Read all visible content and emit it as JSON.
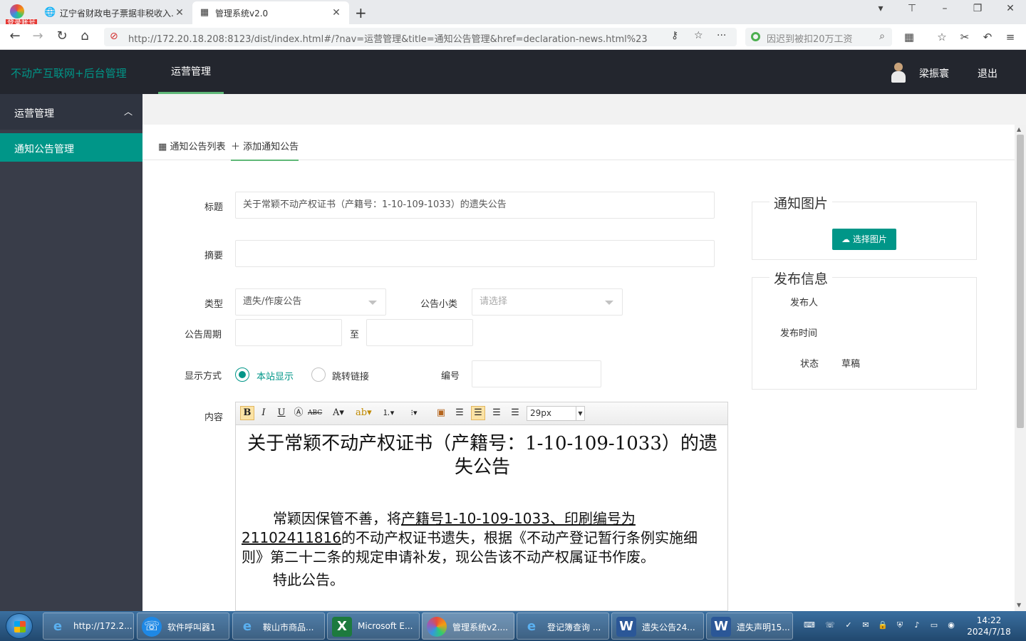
{
  "browser": {
    "login_badge": "登录账号",
    "tabs": [
      {
        "title": "辽宁省财政电子票据非税收入..."
      },
      {
        "title": "管理系统v2.0"
      }
    ],
    "url": "http://172.20.18.208:8123/dist/index.html#/?nav=运营管理&title=通知公告管理&href=declaration-news.html%23",
    "search_text": "因迟到被扣20万工资"
  },
  "app": {
    "brand": "不动产互联网+后台管理",
    "nav_item": "运营管理",
    "user_name": "梁振寰",
    "logout": "退出"
  },
  "sidebar": {
    "group": "运营管理",
    "item": "通知公告管理"
  },
  "page_tabs": {
    "list": "通知公告列表",
    "add": "添加通知公告"
  },
  "form": {
    "title_label": "标题",
    "title_value": "关于常颖不动产权证书（产籍号：1-10-109-1033）的遗失公告",
    "summary_label": "摘要",
    "summary_value": "",
    "type_label": "类型",
    "type_value": "遗失/作废公告",
    "subtype_label": "公告小类",
    "subtype_placeholder": "请选择",
    "period_label": "公告周期",
    "period_to": "至",
    "display_label": "显示方式",
    "display_options": [
      "本站显示",
      "跳转链接"
    ],
    "display_selected": "本站显示",
    "number_label": "编号",
    "content_label": "内容"
  },
  "editor": {
    "font_size": "29px",
    "heading": "关于常颖不动产权证书（产籍号：1-10-109-1033）的遗失公告",
    "body_pre": "常颖因保管不善，将",
    "body_underlined": "产籍号1-10-109-1033、印刷编号为21102411816",
    "body_post": "的不动产权证书遗失，根据《不动产登记暂行条例实施细则》第二十二条的规定申请补发，现公告该不动产权属证书作废。",
    "closing": "特此公告。"
  },
  "right_panel": {
    "image_legend": "通知图片",
    "pick_button": "选择图片",
    "publish_legend": "发布信息",
    "publisher_label": "发布人",
    "publish_time_label": "发布时间",
    "status_label": "状态",
    "status_value": "草稿"
  },
  "taskbar": {
    "tasks": [
      "http://172.2...",
      "软件呼叫器1",
      "鞍山市商品...",
      "Microsoft E...",
      "管理系统v2....",
      "登记簿查询 ...",
      "遗失公告24...",
      "遗失声明15..."
    ],
    "time": "14:22",
    "date": "2024/7/18"
  },
  "colors": {
    "accent": "#009688",
    "header_bg": "#23262e",
    "sidebar_bg": "#393d49"
  }
}
